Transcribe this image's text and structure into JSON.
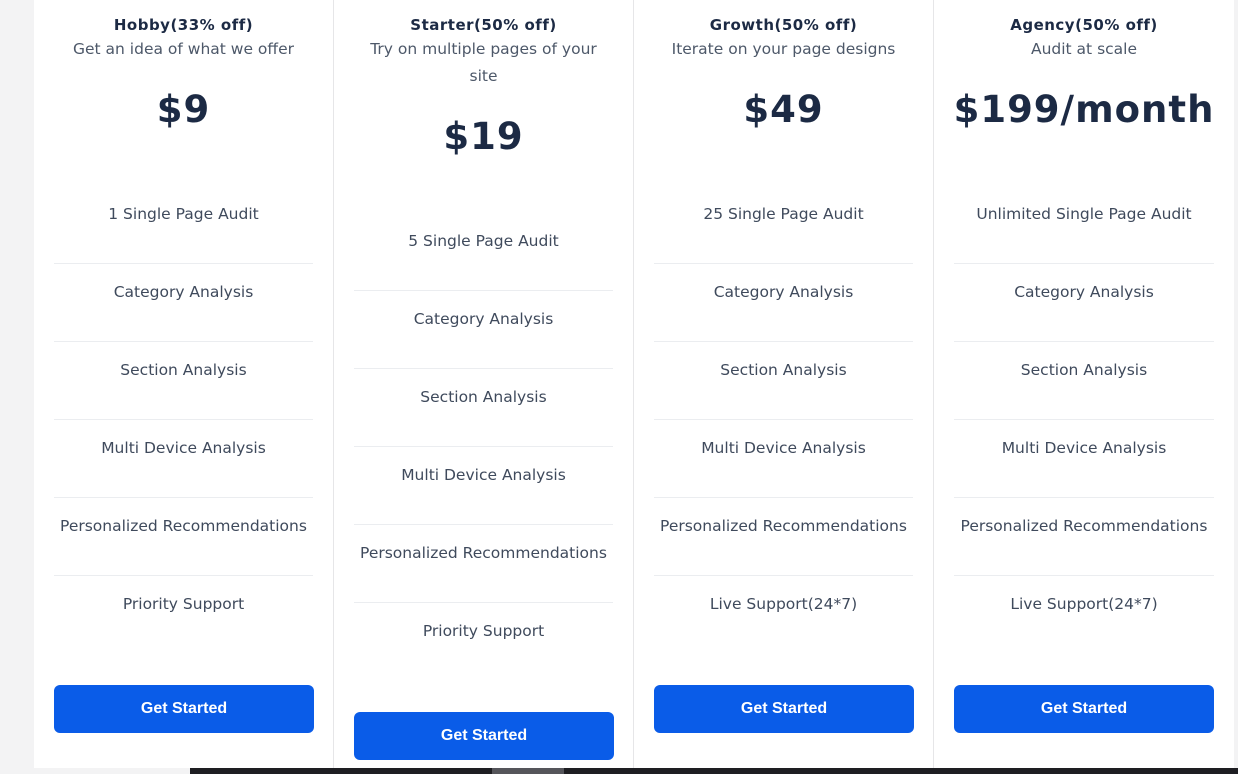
{
  "plans": [
    {
      "title": "Hobby(33% off)",
      "subtitle": "Get an idea of what we offer",
      "price": "$9",
      "features": [
        "1 Single Page Audit",
        "Category Analysis",
        "Section Analysis",
        "Multi Device Analysis",
        "Personalized Recommendations",
        "Priority Support"
      ],
      "button": "Get Started"
    },
    {
      "title": "Starter(50% off)",
      "subtitle": "Try on multiple pages of your site",
      "price": "$19",
      "features": [
        "5 Single Page Audit",
        "Category Analysis",
        "Section Analysis",
        "Multi Device Analysis",
        "Personalized Recommendations",
        "Priority Support"
      ],
      "button": "Get Started"
    },
    {
      "title": "Growth(50% off)",
      "subtitle": "Iterate on your page designs",
      "price": "$49",
      "features": [
        "25 Single Page Audit",
        "Category Analysis",
        "Section Analysis",
        "Multi Device Analysis",
        "Personalized Recommendations",
        "Live Support(24*7)"
      ],
      "button": "Get Started"
    },
    {
      "title": "Agency(50% off)",
      "subtitle": "Audit at scale",
      "price": "$199/month",
      "features": [
        "Unlimited Single Page Audit",
        "Category Analysis",
        "Section Analysis",
        "Multi Device Analysis",
        "Personalized Recommendations",
        "Live Support(24*7)"
      ],
      "button": "Get Started"
    }
  ],
  "colors": {
    "accent": "#0a5ce8",
    "text": "#1c2a44"
  }
}
